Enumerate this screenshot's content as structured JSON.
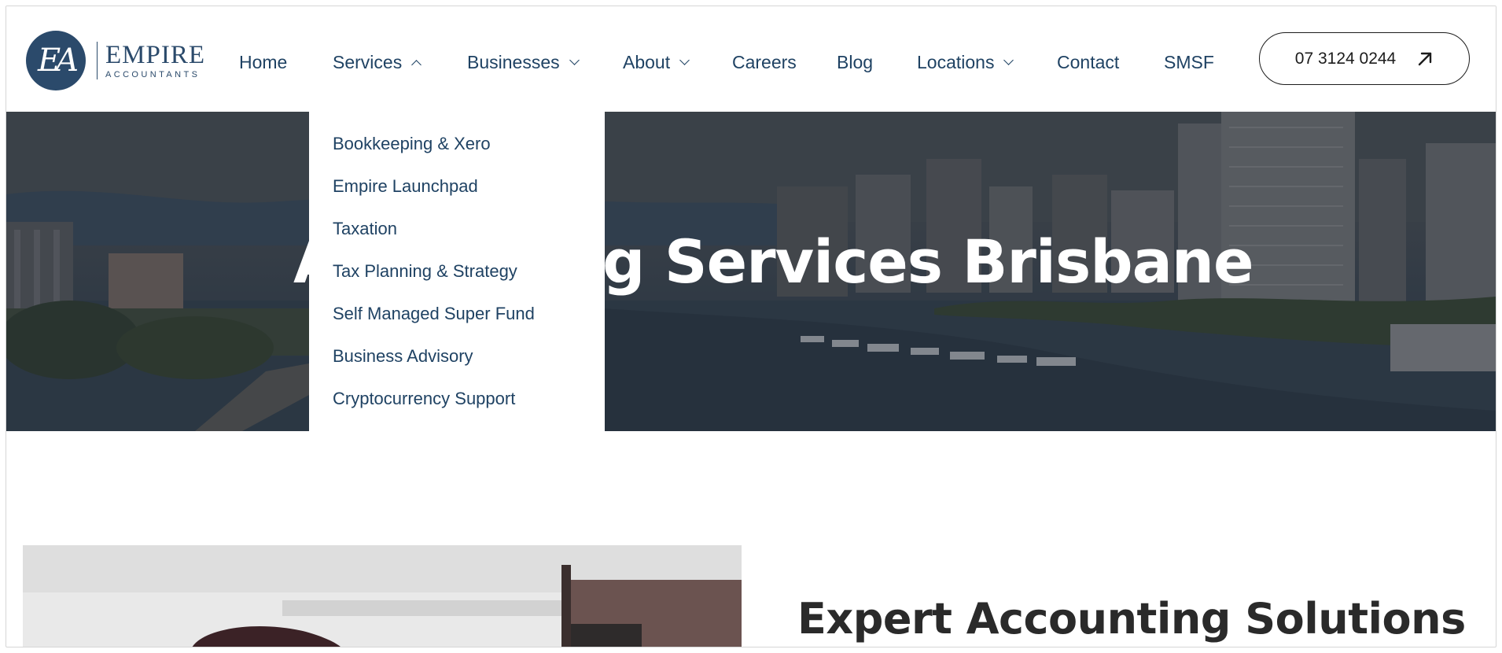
{
  "brand": {
    "monogram": "EA",
    "name": "EMPIRE",
    "tagline": "ACCOUNTANTS",
    "color": "#2b4a6b"
  },
  "nav": {
    "home": "Home",
    "services": "Services",
    "businesses": "Businesses",
    "about": "About",
    "careers": "Careers",
    "blog": "Blog",
    "locations": "Locations",
    "contact": "Contact",
    "smsf": "SMSF"
  },
  "phone_button": {
    "label": "07 3124 0244",
    "icon": "arrow-up-right-icon"
  },
  "services_dropdown": {
    "open": true,
    "items": [
      "Bookkeeping & Xero",
      "Empire Launchpad",
      "Taxation",
      "Tax Planning & Strategy",
      "Self Managed Super Fund",
      "Business Advisory",
      "Cryptocurrency Support"
    ]
  },
  "hero": {
    "title_visible_left": "A",
    "title_visible_right": "g Services Brisbane"
  },
  "intro": {
    "heading": "Expert Accounting Solutions"
  },
  "colors": {
    "nav_text": "#1f4263",
    "heading_text": "#2a2a2a",
    "hero_overlay": "#3d4751"
  }
}
